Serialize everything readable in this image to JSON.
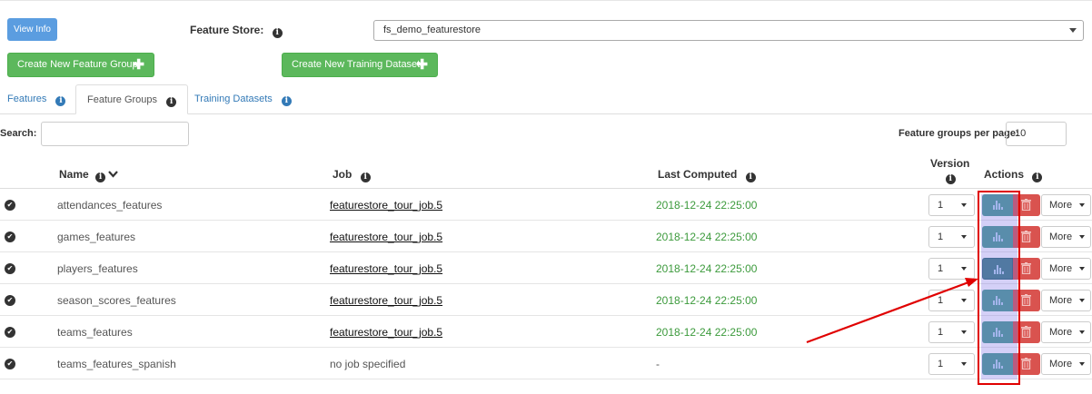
{
  "header": {
    "view_info_label": "View Info",
    "feature_store_label": "Feature Store:",
    "feature_store_value": "fs_demo_featurestore",
    "create_feature_group_label": "Create New Feature Group",
    "create_training_dataset_label": "Create New Training Dataset"
  },
  "tabs": [
    {
      "label": "Features",
      "active": false
    },
    {
      "label": "Feature Groups",
      "active": true
    },
    {
      "label": "Training Datasets",
      "active": false
    }
  ],
  "search": {
    "label": "Search:",
    "value": ""
  },
  "per_page": {
    "label": "Feature groups per page:",
    "value": "10"
  },
  "table": {
    "columns": {
      "name": "Name",
      "job": "Job",
      "last_computed": "Last Computed",
      "version": "Version",
      "actions": "Actions"
    },
    "rows": [
      {
        "name": "attendances_features",
        "job": "featurestore_tour_job.5",
        "last_computed": "2018-12-24 22:25:00",
        "version": "1",
        "more": "More"
      },
      {
        "name": "games_features",
        "job": "featurestore_tour_job.5",
        "last_computed": "2018-12-24 22:25:00",
        "version": "1",
        "more": "More"
      },
      {
        "name": "players_features",
        "job": "featurestore_tour_job.5",
        "last_computed": "2018-12-24 22:25:00",
        "version": "1",
        "more": "More"
      },
      {
        "name": "season_scores_features",
        "job": "featurestore_tour_job.5",
        "last_computed": "2018-12-24 22:25:00",
        "version": "1",
        "more": "More"
      },
      {
        "name": "teams_features",
        "job": "featurestore_tour_job.5",
        "last_computed": "2018-12-24 22:25:00",
        "version": "1",
        "more": "More"
      },
      {
        "name": "teams_features_spanish",
        "job": "no job specified",
        "last_computed": "-",
        "version": "1",
        "more": "More"
      }
    ]
  },
  "colors": {
    "primary_blue": "#5b9de0",
    "success_green": "#5cb85c",
    "danger_red": "#d9534f",
    "stats_teal": "#4a9c8f",
    "computed_text_green": "#3c9a3c",
    "annotation_red": "#e00000",
    "highlight_purple": "#786ee6"
  },
  "icons": {
    "info": "info-circle-icon",
    "sort": "chevron-down-icon",
    "status": "check-circle-icon",
    "stats": "bar-chart-icon",
    "delete": "trash-icon",
    "add": "plus-icon"
  }
}
